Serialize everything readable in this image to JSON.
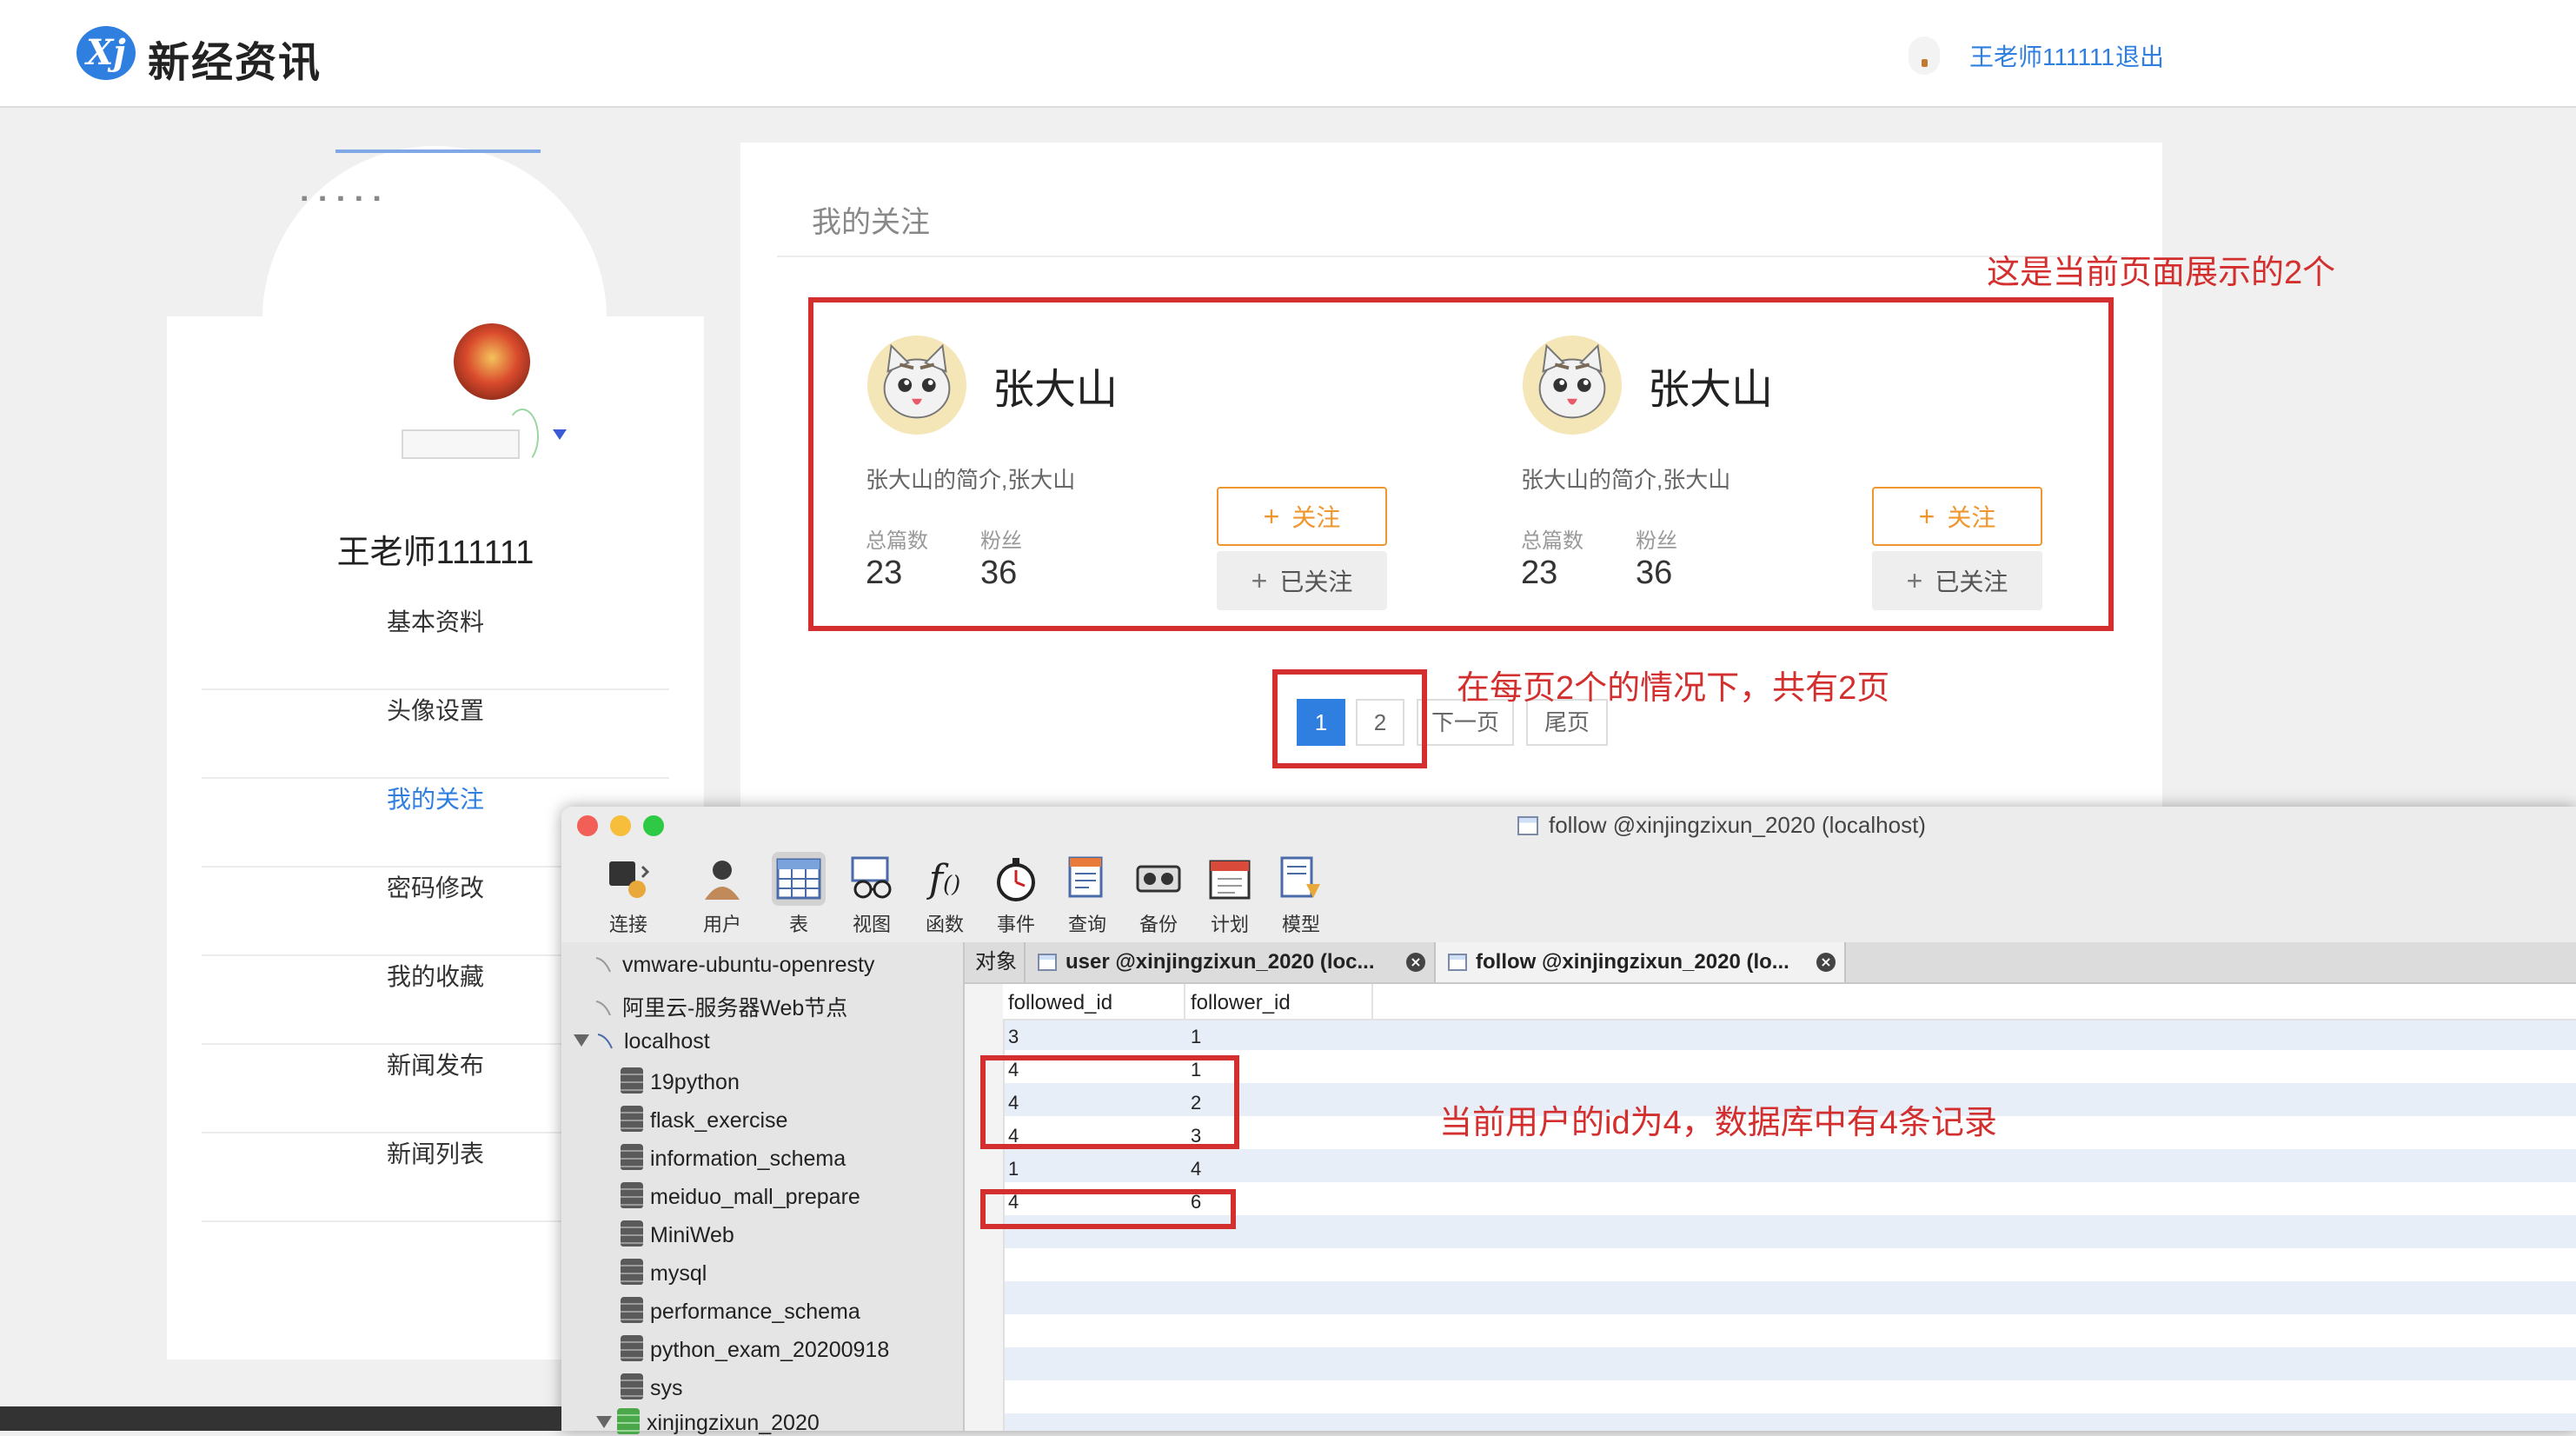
{
  "header": {
    "logo_mark": "Xj",
    "logo_text": "新经资讯",
    "user_name": "王老师111111",
    "logout": "退出"
  },
  "sidebar": {
    "user_name": "王老师111111",
    "items": [
      {
        "label": "基本资料",
        "active": false
      },
      {
        "label": "头像设置",
        "active": false
      },
      {
        "label": "我的关注",
        "active": true
      },
      {
        "label": "密码修改",
        "active": false
      },
      {
        "label": "我的收藏",
        "active": false
      },
      {
        "label": "新闻发布",
        "active": false
      },
      {
        "label": "新闻列表",
        "active": false
      }
    ]
  },
  "main": {
    "title": "我的关注",
    "cards": [
      {
        "name": "张大山",
        "intro": "张大山的简介,张大山",
        "stat1_label": "总篇数",
        "stat1_value": "23",
        "stat2_label": "粉丝",
        "stat2_value": "36",
        "follow_label": "关注",
        "followed_label": "已关注"
      },
      {
        "name": "张大山",
        "intro": "张大山的简介,张大山",
        "stat1_label": "总篇数",
        "stat1_value": "23",
        "stat2_label": "粉丝",
        "stat2_value": "36",
        "follow_label": "关注",
        "followed_label": "已关注"
      }
    ],
    "pagination": {
      "pages": [
        "1",
        "2"
      ],
      "current": "1",
      "next": "下一页",
      "last": "尾页"
    }
  },
  "annotations": {
    "cards_note": "这是当前页面展示的2个",
    "pages_note": "在每页2个的情况下，共有2页",
    "db_note": "当前用户的id为4，数据库中有4条记录",
    "color": "#d32f2f"
  },
  "db_window": {
    "title": "follow @xinjingzixun_2020 (localhost)",
    "toolbar": [
      {
        "label": "连接",
        "icon": "plug-icon"
      },
      {
        "label": "用户",
        "icon": "user-icon"
      },
      {
        "label": "表",
        "icon": "table-icon",
        "selected": true
      },
      {
        "label": "视图",
        "icon": "glasses-icon"
      },
      {
        "label": "函数",
        "icon": "function-icon"
      },
      {
        "label": "事件",
        "icon": "stopwatch-icon"
      },
      {
        "label": "查询",
        "icon": "query-icon"
      },
      {
        "label": "备份",
        "icon": "tape-icon"
      },
      {
        "label": "计划",
        "icon": "calendar-icon"
      },
      {
        "label": "模型",
        "icon": "model-icon"
      }
    ],
    "connections": [
      {
        "label": "vmware-ubuntu-openresty"
      },
      {
        "label": "阿里云-服务器Web节点"
      },
      {
        "label": "localhost",
        "expanded": true
      }
    ],
    "databases": [
      "19python",
      "flask_exercise",
      "information_schema",
      "meiduo_mall_prepare",
      "MiniWeb",
      "mysql",
      "performance_schema",
      "python_exam_20200918",
      "sys",
      "xinjingzixun_2020"
    ],
    "tabs": [
      {
        "label": "对象"
      },
      {
        "label": "user @xinjingzixun_2020 (loc..."
      },
      {
        "label": "follow @xinjingzixun_2020 (lo...",
        "selected": true
      }
    ],
    "columns": [
      "followed_id",
      "follower_id"
    ],
    "rows": [
      [
        "3",
        "1"
      ],
      [
        "4",
        "1"
      ],
      [
        "4",
        "2"
      ],
      [
        "4",
        "3"
      ],
      [
        "1",
        "4"
      ],
      [
        "4",
        "6"
      ]
    ]
  }
}
